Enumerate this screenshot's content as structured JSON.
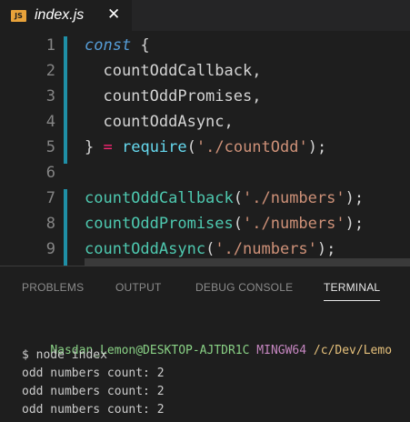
{
  "tab": {
    "badge": "JS",
    "filename": "index.js",
    "close": "✕"
  },
  "editor": {
    "lines": [
      {
        "num": "1",
        "tokens": [
          [
            "kw",
            "const"
          ],
          [
            "plain",
            " {"
          ]
        ]
      },
      {
        "num": "2",
        "tokens": [
          [
            "plain",
            "  countOddCallback,"
          ]
        ]
      },
      {
        "num": "3",
        "tokens": [
          [
            "plain",
            "  countOddPromises,"
          ]
        ]
      },
      {
        "num": "4",
        "tokens": [
          [
            "plain",
            "  countOddAsync,"
          ]
        ]
      },
      {
        "num": "5",
        "tokens": [
          [
            "plain",
            "} "
          ],
          [
            "op",
            "="
          ],
          [
            "plain",
            " "
          ],
          [
            "fn2",
            "require"
          ],
          [
            "plain",
            "("
          ],
          [
            "str",
            "'./countOdd'"
          ],
          [
            "plain",
            ");"
          ]
        ]
      },
      {
        "num": "6",
        "tokens": []
      },
      {
        "num": "7",
        "tokens": [
          [
            "fn",
            "countOddCallback"
          ],
          [
            "plain",
            "("
          ],
          [
            "str",
            "'./numbers'"
          ],
          [
            "plain",
            ");"
          ]
        ]
      },
      {
        "num": "8",
        "tokens": [
          [
            "fn",
            "countOddPromises"
          ],
          [
            "plain",
            "("
          ],
          [
            "str",
            "'./numbers'"
          ],
          [
            "plain",
            ");"
          ]
        ]
      },
      {
        "num": "9",
        "tokens": [
          [
            "fn",
            "countOddAsync"
          ],
          [
            "plain",
            "("
          ],
          [
            "str",
            "'./numbers'"
          ],
          [
            "plain",
            ");"
          ]
        ]
      }
    ]
  },
  "panel": {
    "tabs": [
      "PROBLEMS",
      "OUTPUT",
      "DEBUG CONSOLE",
      "TERMINAL"
    ],
    "active_tab": "TERMINAL",
    "terminal": {
      "user": "Nasdan_Lemon@DESKTOP-AJTDR1C",
      "system": "MINGW64",
      "path": "/c/Dev/Lemo",
      "command": "$ node index",
      "output": [
        "odd numbers count: 2",
        "odd numbers count: 2",
        "odd numbers count: 2"
      ]
    }
  }
}
